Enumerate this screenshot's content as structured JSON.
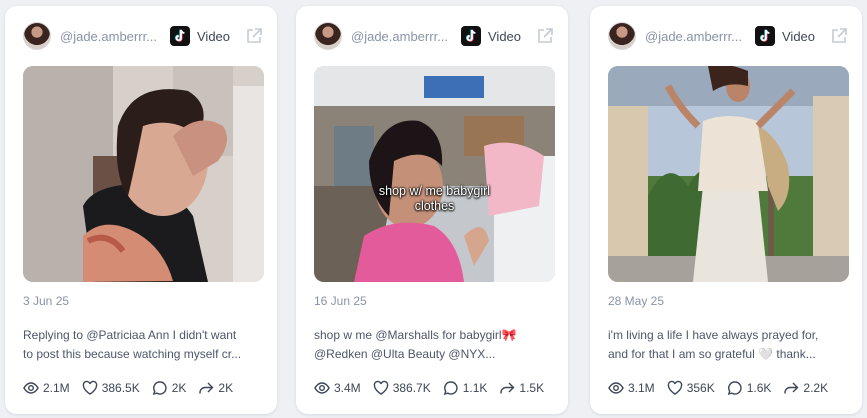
{
  "cards": [
    {
      "username": "@jade.amberrr...",
      "type_label": "Video",
      "date": "3 Jun 25",
      "caption_line1": "Replying to @Patriciaa Ann I didn't want",
      "caption_line2": "to post this because watching myself cr...",
      "overlay_text": "",
      "stats": {
        "views": "2.1M",
        "likes": "386.5K",
        "comments": "2K",
        "shares": "2K"
      }
    },
    {
      "username": "@jade.amberrr...",
      "type_label": "Video",
      "date": "16 Jun 25",
      "caption_line1": "shop w me @Marshalls for babygirl🎀",
      "caption_line2": "@Redken @Ulta Beauty @NYX...",
      "overlay_text": "shop w/ me babygirl clothes",
      "stats": {
        "views": "3.4M",
        "likes": "386.7K",
        "comments": "1.1K",
        "shares": "1.5K"
      }
    },
    {
      "username": "@jade.amberrr...",
      "type_label": "Video",
      "date": "28 May 25",
      "caption_line1": "i'm living a life I have always prayed for,",
      "caption_line2": "and for that I am so grateful 🤍 thank...",
      "overlay_text": "",
      "stats": {
        "views": "3.1M",
        "likes": "356K",
        "comments": "1.6K",
        "shares": "2.2K"
      }
    }
  ],
  "icons": {
    "platform": "tiktok-icon",
    "external": "external-link-icon",
    "views": "eye-icon",
    "likes": "heart-icon",
    "comments": "comment-icon",
    "shares": "share-icon"
  }
}
